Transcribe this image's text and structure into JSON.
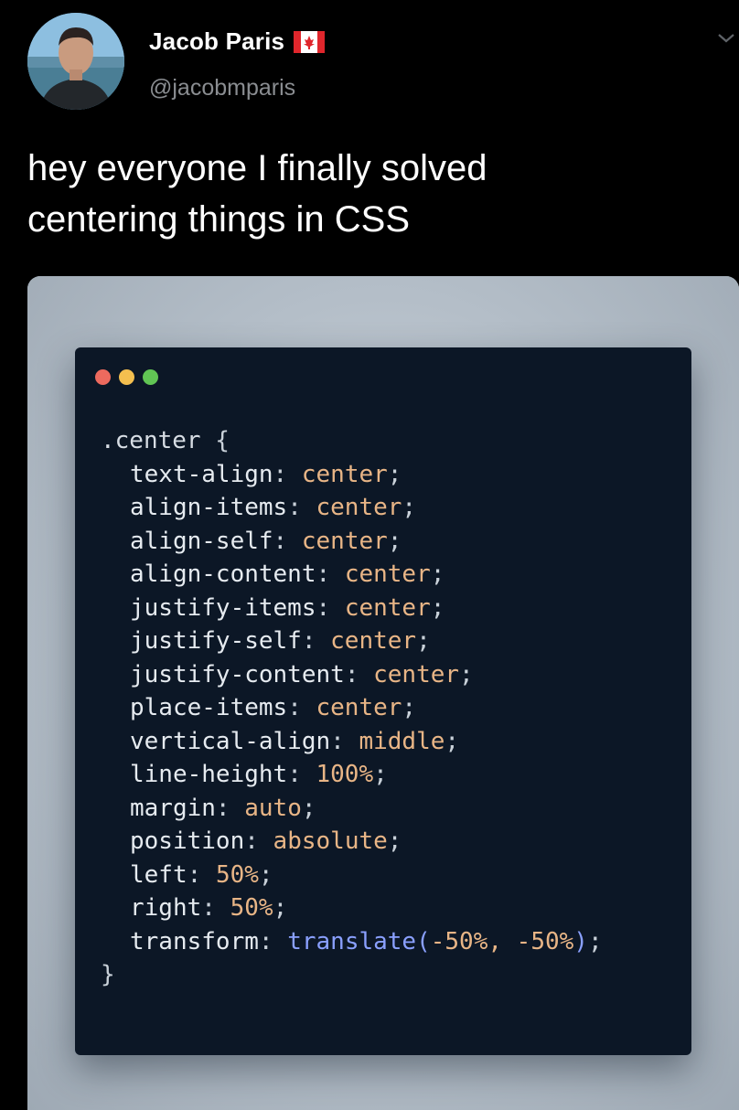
{
  "author": {
    "name": "Jacob Paris",
    "handle": "@jacobmparis",
    "avatar_icon": "profile-photo",
    "flag_icon": "canada-flag-icon"
  },
  "tweet": {
    "lines": [
      "hey everyone I finally solved",
      "centering things in CSS"
    ]
  },
  "menu_icon": "chevron-down-icon",
  "code_window": {
    "traffic_lights": [
      "#ed6a5e",
      "#f4bf4f",
      "#61c554"
    ],
    "selector": ".center",
    "open_brace": "{",
    "close_brace": "}",
    "declarations": [
      {
        "property": "text-align",
        "value": "center"
      },
      {
        "property": "align-items",
        "value": "center"
      },
      {
        "property": "align-self",
        "value": "center"
      },
      {
        "property": "align-content",
        "value": "center"
      },
      {
        "property": "justify-items",
        "value": "center"
      },
      {
        "property": "justify-self",
        "value": "center"
      },
      {
        "property": "justify-content",
        "value": "center"
      },
      {
        "property": "place-items",
        "value": "center"
      },
      {
        "property": "vertical-align",
        "value": "middle"
      },
      {
        "property": "line-height",
        "value": "100%"
      },
      {
        "property": "margin",
        "value": "auto"
      },
      {
        "property": "position",
        "value": "absolute"
      },
      {
        "property": "left",
        "value": "50%"
      },
      {
        "property": "right",
        "value": "50%"
      },
      {
        "property": "transform",
        "func": "translate",
        "args": "-50%, -50%"
      }
    ]
  },
  "colors": {
    "background": "#000000",
    "handle": "#8a8d91",
    "code_bg": "#0c1726",
    "code_value": "#e8b586",
    "code_func": "#8aa0ff"
  }
}
